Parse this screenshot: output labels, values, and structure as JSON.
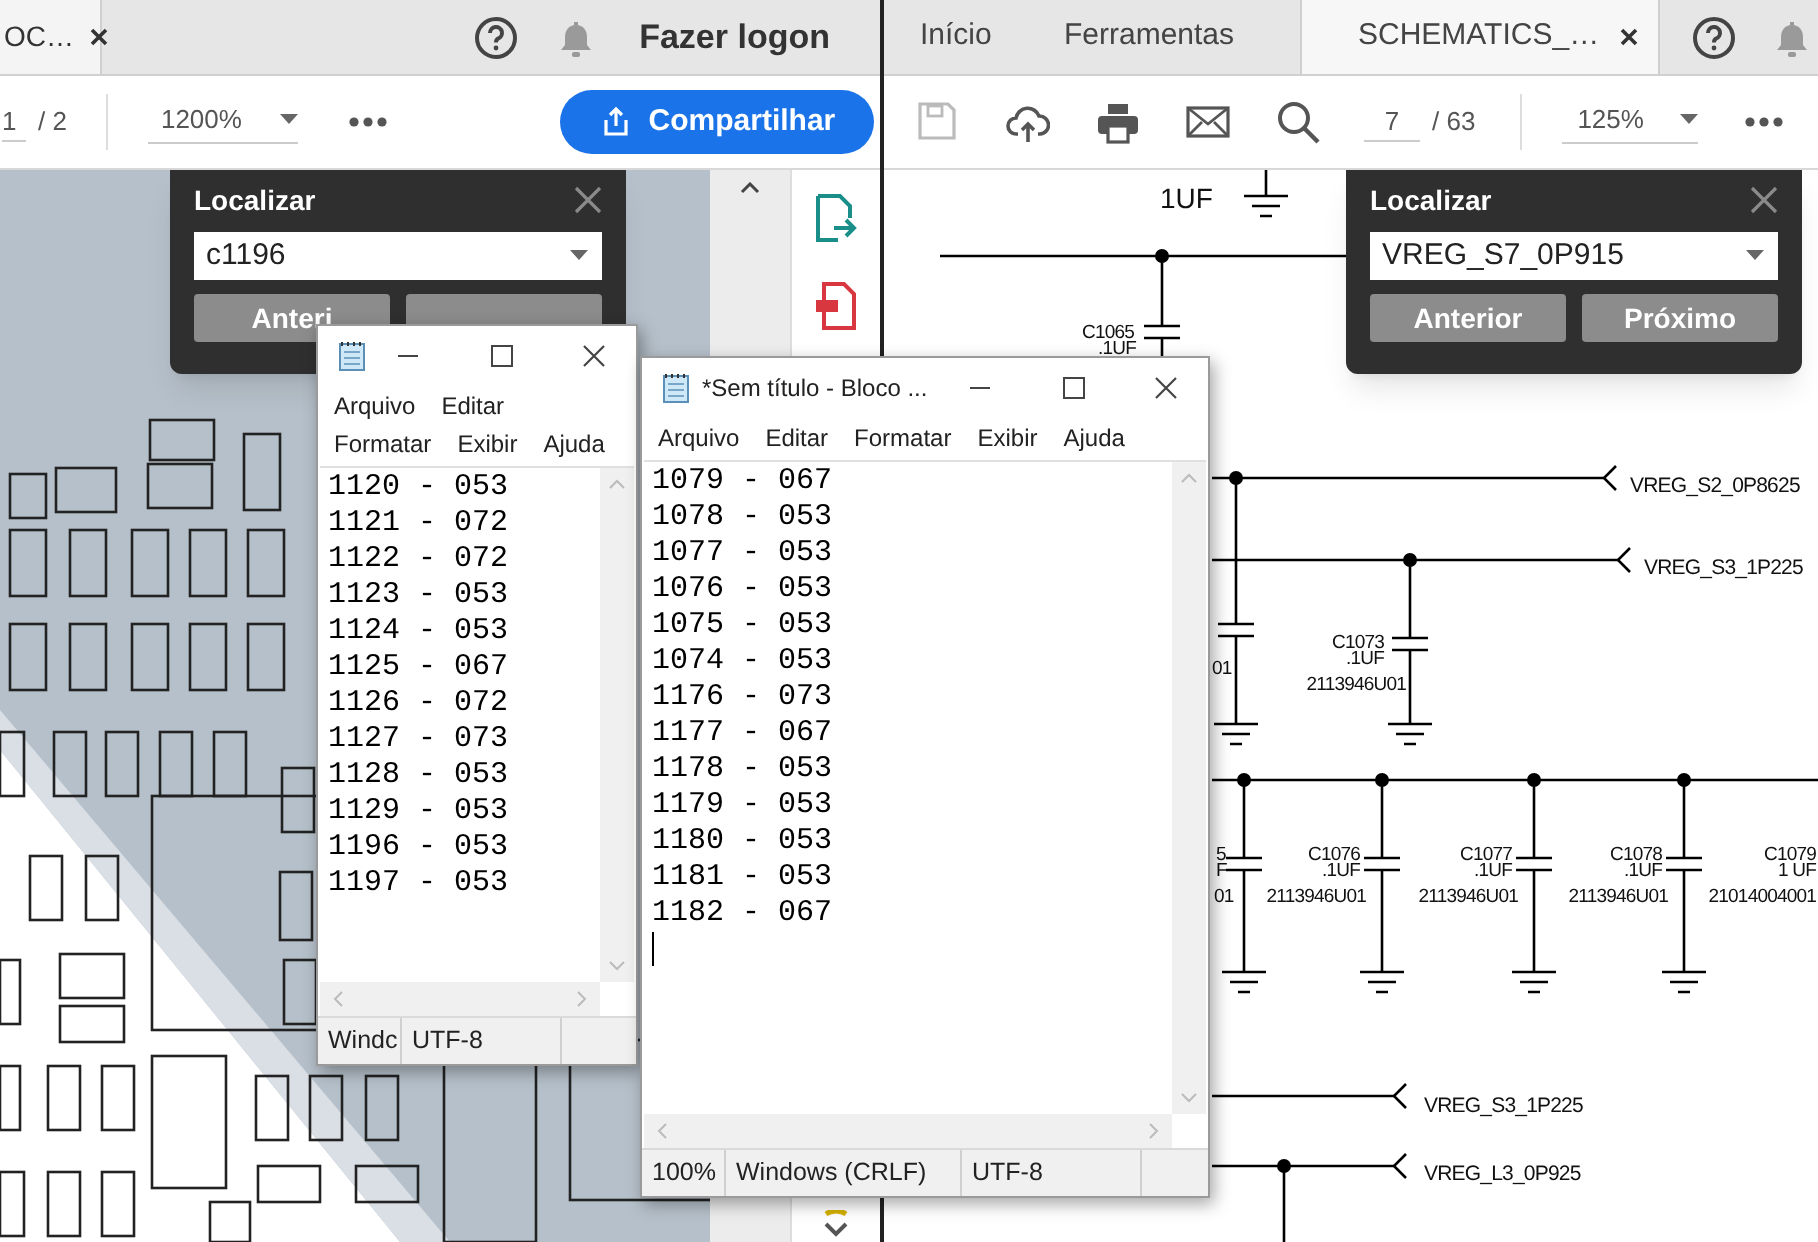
{
  "left_window": {
    "tab": {
      "label": "OC…",
      "selected": true
    },
    "sign_in": "Fazer logon",
    "toolbar": {
      "page_current": "1",
      "page_total": "/ 2",
      "zoom": "1200%",
      "share_button": "Compartilhar"
    },
    "find_panel": {
      "title": "Localizar",
      "value": "c1196",
      "buttons": [
        "Anteri"
      ]
    }
  },
  "right_window": {
    "tabs": [
      {
        "label": "Início",
        "selected": false
      },
      {
        "label": "Ferramentas",
        "selected": false
      },
      {
        "label": "SCHEMATICS_…",
        "selected": true
      }
    ],
    "toolbar": {
      "page_current": "7",
      "page_total": "/ 63",
      "zoom": "125%"
    },
    "find_panel": {
      "title": "Localizar",
      "value": "VREG_S7_0P915",
      "buttons": [
        "Anterior",
        "Próximo"
      ]
    },
    "schematic": {
      "labels": [
        {
          "text": "1UF",
          "kind": "value"
        },
        {
          "text": "C1065",
          "kind": "part"
        },
        {
          "text": ".1UF",
          "kind": "part"
        },
        {
          "text": "VREG_S2_0P8625",
          "kind": "net"
        },
        {
          "text": "VREG_S3_1P225",
          "kind": "net"
        },
        {
          "text": "01",
          "kind": "part"
        },
        {
          "text": "C1073",
          "kind": "part"
        },
        {
          "text": ".1UF",
          "kind": "part"
        },
        {
          "text": "2113946U01",
          "kind": "part"
        },
        {
          "text": "5",
          "kind": "part"
        },
        {
          "text": "F",
          "kind": "part"
        },
        {
          "text": "01",
          "kind": "part"
        },
        {
          "text": "C1076",
          "kind": "part"
        },
        {
          "text": ".1UF",
          "kind": "part"
        },
        {
          "text": "2113946U01",
          "kind": "part"
        },
        {
          "text": "C1077",
          "kind": "part"
        },
        {
          "text": ".1UF",
          "kind": "part"
        },
        {
          "text": "2113946U01",
          "kind": "part"
        },
        {
          "text": "C1078",
          "kind": "part"
        },
        {
          "text": ".1UF",
          "kind": "part"
        },
        {
          "text": "2113946U01",
          "kind": "part"
        },
        {
          "text": "C1079",
          "kind": "part"
        },
        {
          "text": "1 UF",
          "kind": "part"
        },
        {
          "text": "21014004001",
          "kind": "part"
        },
        {
          "text": "VREG_S3_1P225",
          "kind": "net"
        },
        {
          "text": "VREG_L3_0P925",
          "kind": "net"
        }
      ]
    }
  },
  "notepads": [
    {
      "menu": [
        "Arquivo",
        "Editar",
        "Formatar",
        "Exibir",
        "Ajuda"
      ],
      "lines": [
        "1120 - 053",
        "1121 - 072",
        "1122 - 072",
        "1123 - 053",
        "1124 - 053",
        "1125 - 067",
        "1126 - 072",
        "1127 - 073",
        "1128 - 053",
        "1129 - 053",
        "1196 - 053",
        "1197 - 053"
      ],
      "caret": false,
      "status": [
        "Windc",
        "UTF-8"
      ]
    },
    {
      "title": "*Sem título - Bloco ...",
      "menu": [
        "Arquivo",
        "Editar",
        "Formatar",
        "Exibir",
        "Ajuda"
      ],
      "lines": [
        "1079 - 067",
        "1078 - 053",
        "1077 - 053",
        "1076 - 053",
        "1075 - 053",
        "1074 - 053",
        "1176 - 073",
        "1177 - 067",
        "1178 - 053",
        "1179 - 053",
        "1180 - 053",
        "1181 - 053",
        "1182 - 067"
      ],
      "caret": true,
      "status": [
        "100%",
        "Windows (CRLF)",
        "UTF-8"
      ]
    }
  ]
}
